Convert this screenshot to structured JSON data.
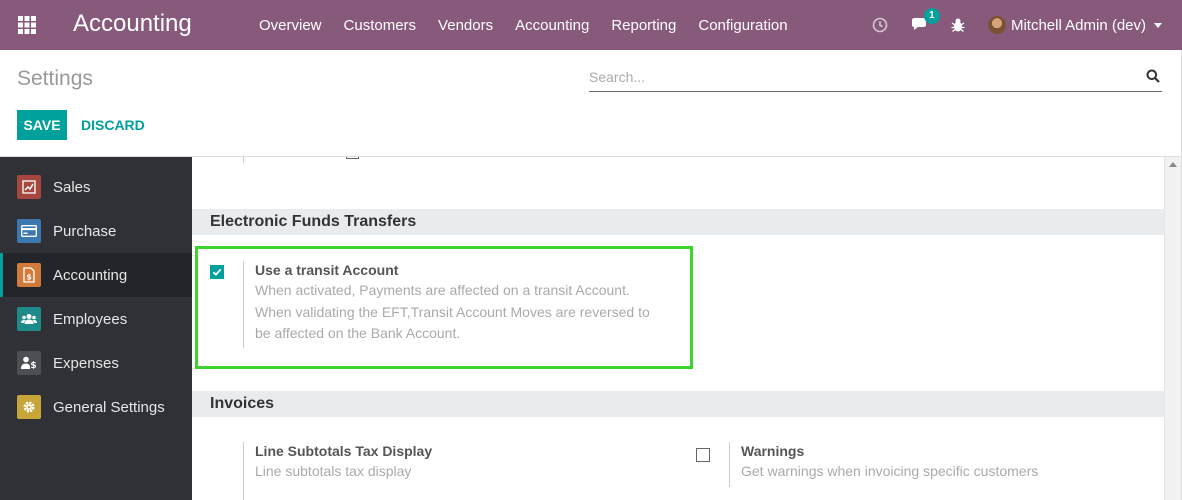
{
  "navbar": {
    "app_name": "Accounting",
    "menu": [
      "Overview",
      "Customers",
      "Vendors",
      "Accounting",
      "Reporting",
      "Configuration"
    ],
    "messages_badge": "1",
    "user": "Mitchell Admin (dev)",
    "color": "#875a7b"
  },
  "control_panel": {
    "breadcrumb": "Settings",
    "search_placeholder": "Search...",
    "save_label": "SAVE",
    "discard_label": "DISCARD",
    "accent": "#00a09d"
  },
  "sidebar": {
    "items": [
      {
        "label": "Sales",
        "icon": "sales-chart-icon",
        "color": "#a5473f"
      },
      {
        "label": "Purchase",
        "icon": "credit-card-icon",
        "color": "#3c78b0"
      },
      {
        "label": "Accounting",
        "icon": "invoice-dollar-icon",
        "color": "#d27a3a",
        "active": true
      },
      {
        "label": "Employees",
        "icon": "people-icon",
        "color": "#1e8b8a"
      },
      {
        "label": "Expenses",
        "icon": "expenses-icon",
        "color": "#4d4f55"
      },
      {
        "label": "General Settings",
        "icon": "gear-icon",
        "color": "#c8a538"
      }
    ]
  },
  "sections": [
    {
      "title": "Electronic Funds Transfers",
      "settings": [
        {
          "label": "Use a transit Account",
          "help_lines": [
            "When activated, Payments are affected on a transit Account.",
            "When validating the EFT,Transit Account Moves are reversed to",
            "be affected on the Bank Account."
          ],
          "checked": true
        }
      ]
    },
    {
      "title": "Invoices",
      "settings": [
        {
          "label": "Line Subtotals Tax Display",
          "help": "Line subtotals tax display"
        },
        {
          "label": "Warnings",
          "help": "Get warnings when invoicing specific customers",
          "checked": false
        }
      ]
    }
  ]
}
